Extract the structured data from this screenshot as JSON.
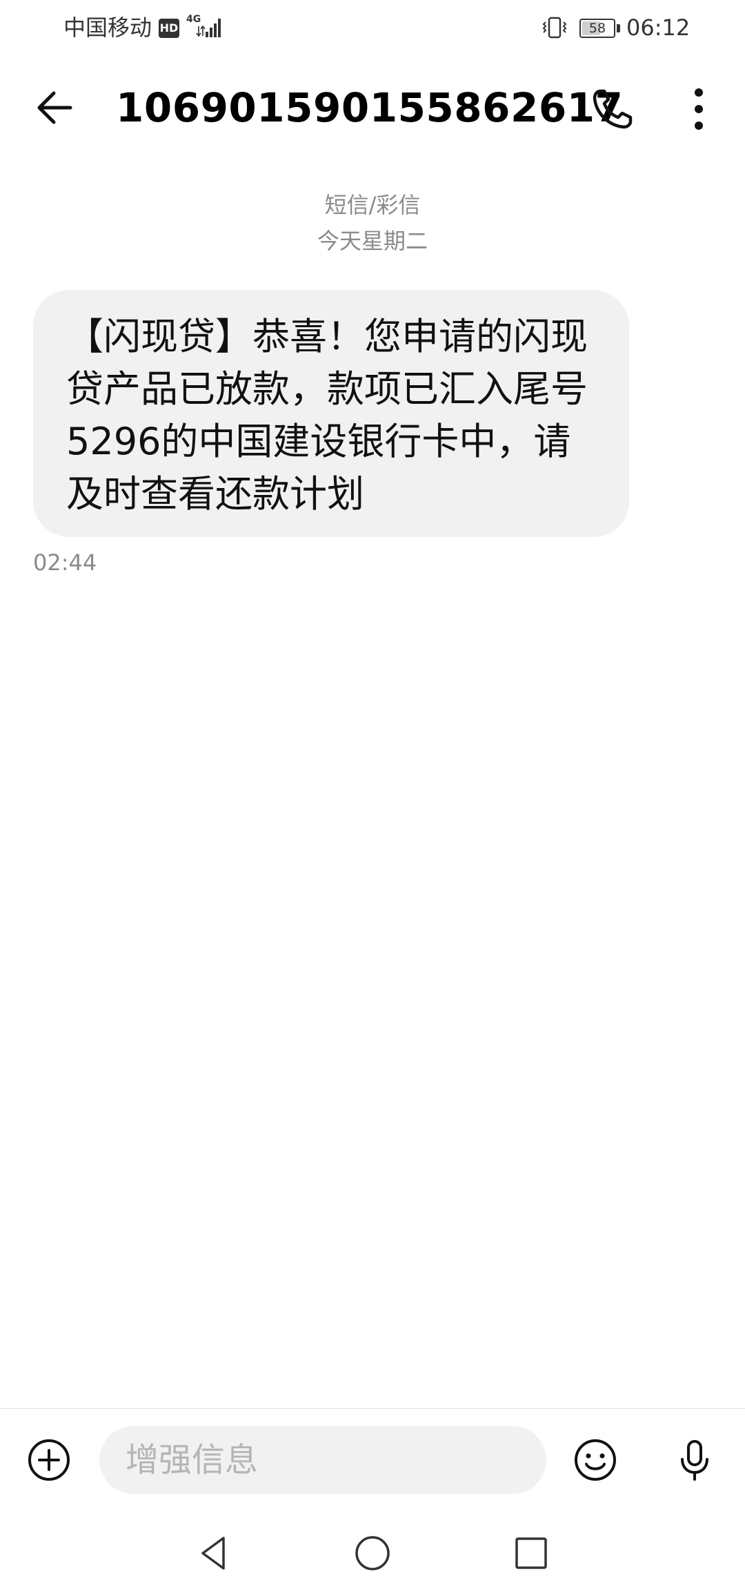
{
  "status_bar": {
    "carrier": "中国移动",
    "hd_badge": "HD",
    "network_type": "4G",
    "battery_level": 58,
    "battery_label": "58",
    "time": "06:12",
    "icons": [
      "signal-icon",
      "vibrate-icon",
      "battery-icon"
    ]
  },
  "header": {
    "title": "106901590155862617",
    "icons": [
      "back-arrow-icon",
      "phone-icon",
      "more-vertical-icon"
    ]
  },
  "conversation": {
    "message_type_label": "短信/彩信",
    "date_label": "今天星期二",
    "messages": [
      {
        "text": "【闪现贷】恭喜！您申请的闪现贷产品已放款，款项已汇入尾号5296的中国建设银行卡中，请及时查看还款计划",
        "time": "02:44",
        "direction": "incoming"
      }
    ]
  },
  "compose": {
    "placeholder": "增强信息",
    "value": "",
    "icons": [
      "add-circle-icon",
      "emoji-icon",
      "microphone-icon"
    ]
  },
  "nav_bar": {
    "icons": [
      "nav-back-icon",
      "nav-home-icon",
      "nav-recents-icon"
    ]
  },
  "colors": {
    "bubble_background": "#f1f1f1",
    "secondary_text": "#8a8a8a",
    "placeholder_text": "#b5b5b5"
  }
}
